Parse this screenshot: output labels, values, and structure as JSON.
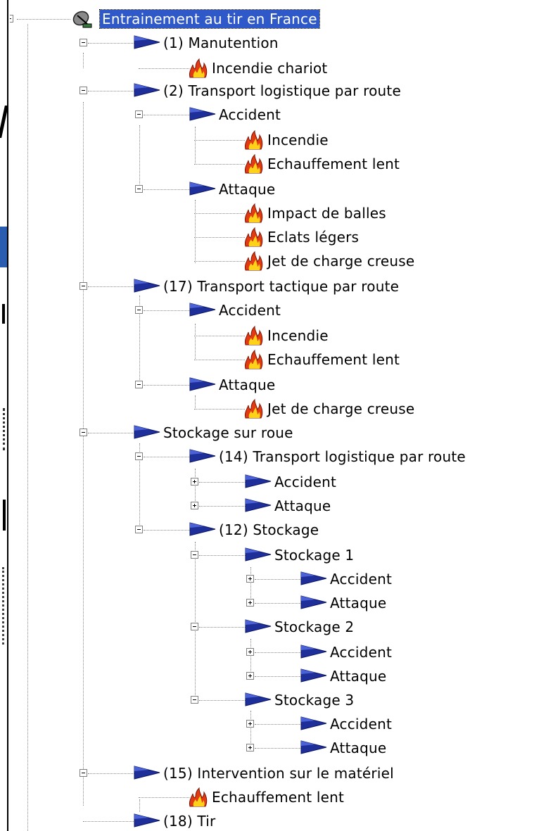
{
  "tree": {
    "root": {
      "label": "Entrainement au tir en France",
      "icon": "satellite-dish-icon",
      "selected": true
    },
    "nodes": [
      {
        "label": "(1) Manutention",
        "icon": "blue-flag-icon"
      },
      {
        "label": "Incendie chariot",
        "icon": "fire-icon"
      },
      {
        "label": "(2) Transport logistique par route",
        "icon": "blue-flag-icon"
      },
      {
        "label": "Accident",
        "icon": "blue-flag-icon"
      },
      {
        "label": "Incendie",
        "icon": "fire-icon"
      },
      {
        "label": "Echauffement lent",
        "icon": "fire-icon"
      },
      {
        "label": "Attaque",
        "icon": "blue-flag-icon"
      },
      {
        "label": "Impact de balles",
        "icon": "fire-icon"
      },
      {
        "label": "Eclats légers",
        "icon": "fire-icon"
      },
      {
        "label": "Jet de charge creuse",
        "icon": "fire-icon"
      },
      {
        "label": "(17) Transport tactique par route",
        "icon": "blue-flag-icon"
      },
      {
        "label": "Accident",
        "icon": "blue-flag-icon"
      },
      {
        "label": "Incendie",
        "icon": "fire-icon"
      },
      {
        "label": "Echauffement lent",
        "icon": "fire-icon"
      },
      {
        "label": "Attaque",
        "icon": "blue-flag-icon"
      },
      {
        "label": "Jet de charge creuse",
        "icon": "fire-icon"
      },
      {
        "label": "Stockage sur roue",
        "icon": "blue-flag-icon"
      },
      {
        "label": "(14) Transport logistique par route",
        "icon": "blue-flag-icon"
      },
      {
        "label": "Accident",
        "icon": "blue-flag-icon"
      },
      {
        "label": "Attaque",
        "icon": "blue-flag-icon"
      },
      {
        "label": "(12) Stockage",
        "icon": "blue-flag-icon"
      },
      {
        "label": "Stockage 1",
        "icon": "blue-flag-icon"
      },
      {
        "label": "Accident",
        "icon": "blue-flag-icon"
      },
      {
        "label": "Attaque",
        "icon": "blue-flag-icon"
      },
      {
        "label": "Stockage 2",
        "icon": "blue-flag-icon"
      },
      {
        "label": "Accident",
        "icon": "blue-flag-icon"
      },
      {
        "label": "Attaque",
        "icon": "blue-flag-icon"
      },
      {
        "label": "Stockage 3",
        "icon": "blue-flag-icon"
      },
      {
        "label": "Accident",
        "icon": "blue-flag-icon"
      },
      {
        "label": "Attaque",
        "icon": "blue-flag-icon"
      },
      {
        "label": "(15) Intervention sur le matériel",
        "icon": "blue-flag-icon"
      },
      {
        "label": "Echauffement lent",
        "icon": "fire-icon"
      },
      {
        "label": "(18) Tir",
        "icon": "blue-flag-icon"
      }
    ]
  },
  "colors": {
    "selection_bg": "#2f58c9",
    "flag_blue": "#1f2f9a",
    "fire_red": "#e23a12",
    "fire_yellow": "#ffd21a"
  }
}
